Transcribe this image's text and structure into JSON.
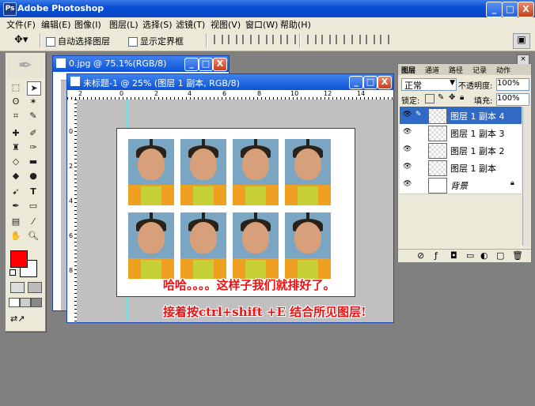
{
  "app": {
    "title": "Adobe Photoshop",
    "icon": "photoshop-icon"
  },
  "window_buttons": {
    "minimize": "_",
    "maximize": "□",
    "close": "X"
  },
  "menu": [
    "文件(F)",
    "编辑(E)",
    "图像(I)",
    "图层(L)",
    "选择(S)",
    "滤镜(T)",
    "视图(V)",
    "窗口(W)",
    "帮助(H)"
  ],
  "options": {
    "auto_select": "自动选择图层",
    "show_bounds": "显示定界框"
  },
  "doc_back": {
    "title": "0.jpg @ 75.1%(RGB/8)"
  },
  "doc_front": {
    "title": "未标题-1 @ 25% (图层 1 副本, RGB/8)",
    "ruler_top": [
      "2",
      "0",
      "2",
      "4",
      "6",
      "8",
      "10",
      "12",
      "14"
    ],
    "ruler_left": [
      "0",
      "2",
      "4",
      "6",
      "8"
    ]
  },
  "layers_panel": {
    "tabs": [
      "图层",
      "通道",
      "路径",
      "记录",
      "动作"
    ],
    "blend_mode": "正常",
    "opacity_label": "不透明度:",
    "opacity": "100%",
    "lock_label": "锁定:",
    "fill_label": "填充:",
    "fill": "100%",
    "layers": [
      {
        "name": "图层 1 副本 4",
        "selected": true
      },
      {
        "name": "图层 1 副本 3",
        "selected": false
      },
      {
        "name": "图层 1 副本 2",
        "selected": false
      },
      {
        "name": "图层 1 副本",
        "selected": false
      },
      {
        "name": "背景",
        "selected": false
      }
    ]
  },
  "captions": {
    "line1": "哈哈。。。。这样子我们就排好了。",
    "line2": "接着按ctrl+shift +E 结合所见图层!"
  },
  "colors": {
    "foreground": "#ff0000",
    "background": "#ffffff",
    "caption": "#ee1111",
    "accent": "#316ac5"
  }
}
